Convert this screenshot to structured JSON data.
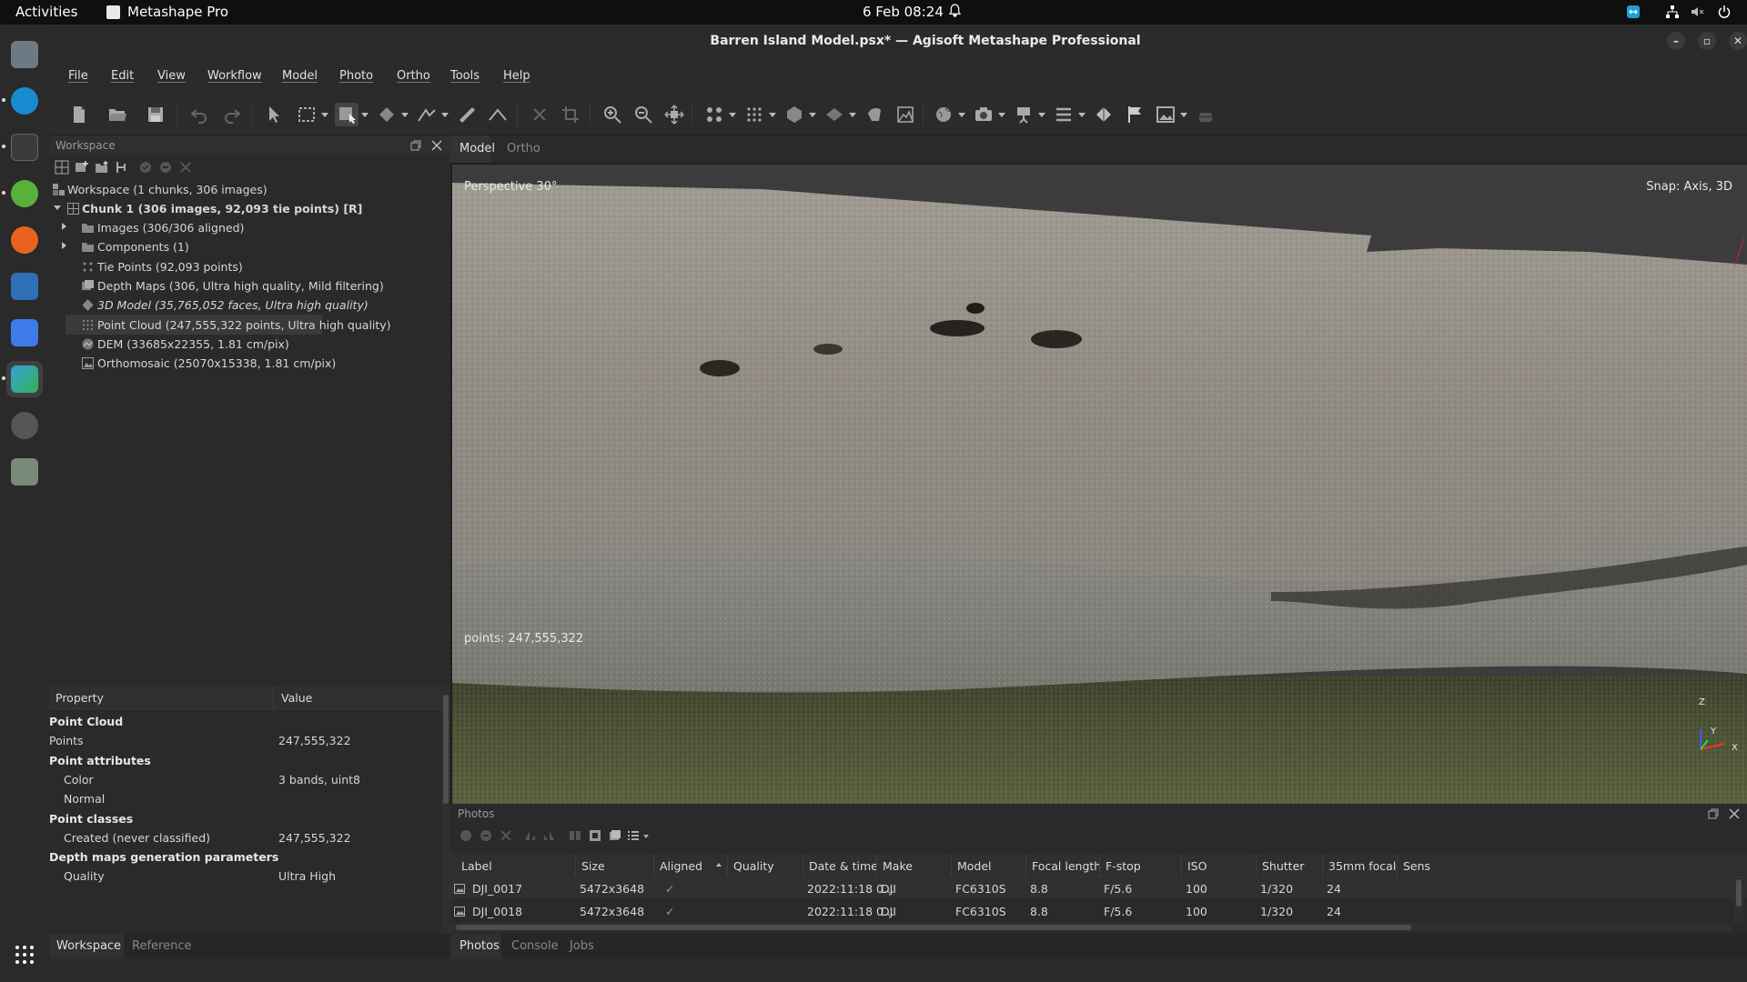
{
  "topbar": {
    "activities": "Activities",
    "app_name": "Metashape Pro",
    "clock": "6 Feb  08:24"
  },
  "window": {
    "title": "Barren Island Model.psx* — Agisoft Metashape Professional"
  },
  "menu": [
    "File",
    "Edit",
    "View",
    "Workflow",
    "Model",
    "Photo",
    "Ortho",
    "Tools",
    "Help"
  ],
  "workspace": {
    "panel_title": "Workspace",
    "root": "Workspace (1 chunks, 306 images)",
    "chunk": "Chunk 1 (306 images, 92,093 tie points) [R]",
    "items": [
      {
        "label": "Images (306/306 aligned)",
        "icon": "folder-icon",
        "expandable": true,
        "italic": false
      },
      {
        "label": "Components (1)",
        "icon": "folder-icon",
        "expandable": true,
        "italic": false
      },
      {
        "label": "Tie Points (92,093 points)",
        "icon": "tie-points-icon",
        "expandable": false,
        "italic": false
      },
      {
        "label": "Depth Maps (306, Ultra high quality, Mild filtering)",
        "icon": "depth-maps-icon",
        "expandable": false,
        "italic": false
      },
      {
        "label": "3D Model (35,765,052 faces, Ultra high quality)",
        "icon": "model-icon",
        "expandable": false,
        "italic": true
      },
      {
        "label": "Point Cloud (247,555,322 points, Ultra high quality)",
        "icon": "point-cloud-icon",
        "expandable": false,
        "italic": false,
        "selected": true
      },
      {
        "label": "DEM (33685x22355, 1.81 cm/pix)",
        "icon": "dem-icon",
        "expandable": false,
        "italic": false
      },
      {
        "label": "Orthomosaic (25070x15338, 1.81 cm/pix)",
        "icon": "orthomosaic-icon",
        "expandable": false,
        "italic": false
      }
    ]
  },
  "properties": {
    "col_property": "Property",
    "col_value": "Value",
    "rows": [
      {
        "key": "Point Cloud",
        "value": "",
        "group": true
      },
      {
        "key": "Points",
        "value": "247,555,322",
        "group": false,
        "indent": false
      },
      {
        "key": "Point attributes",
        "value": "",
        "group": true
      },
      {
        "key": "Color",
        "value": "3 bands, uint8",
        "group": false,
        "indent": true
      },
      {
        "key": "Normal",
        "value": "",
        "group": false,
        "indent": true
      },
      {
        "key": "Point classes",
        "value": "",
        "group": true
      },
      {
        "key": "Created (never classified)",
        "value": "247,555,322",
        "group": false,
        "indent": true
      },
      {
        "key": "Depth maps generation parameters",
        "value": "",
        "group": true
      },
      {
        "key": "Quality",
        "value": "Ultra High",
        "group": false,
        "indent": true
      }
    ]
  },
  "left_tabs": [
    "Workspace",
    "Reference"
  ],
  "viewport": {
    "tabs": [
      "Model",
      "Ortho"
    ],
    "perspective": "Perspective 30°",
    "snap": "Snap: Axis, 3D",
    "points": "points: 247,555,322",
    "axes": {
      "z": "Z",
      "y": "Y",
      "x": "X"
    }
  },
  "photos": {
    "panel_title": "Photos",
    "columns": [
      "Label",
      "Size",
      "Aligned",
      "Quality",
      "Date & time",
      "Make",
      "Model",
      "Focal length",
      "F-stop",
      "ISO",
      "Shutter",
      "35mm focal",
      "Sens"
    ],
    "rows": [
      {
        "label": "DJI_0017",
        "size": "5472x3648",
        "aligned": "✓",
        "quality": "",
        "datetime": "2022:11:18 0...",
        "make": "DJI",
        "model": "FC6310S",
        "focal": "8.8",
        "fstop": "F/5.6",
        "iso": "100",
        "shutter": "1/320",
        "focal35": "24"
      },
      {
        "label": "DJI_0018",
        "size": "5472x3648",
        "aligned": "✓",
        "quality": "",
        "datetime": "2022:11:18 0...",
        "make": "DJI",
        "model": "FC6310S",
        "focal": "8.8",
        "fstop": "F/5.6",
        "iso": "100",
        "shutter": "1/320",
        "focal35": "24"
      }
    ]
  },
  "right_tabs": [
    "Photos",
    "Console",
    "Jobs"
  ],
  "colors": {
    "bg": "#2a2a2a",
    "toolbar": "#2b2b2b",
    "text": "#d6d6d6",
    "selected": "#3a3a3a"
  }
}
